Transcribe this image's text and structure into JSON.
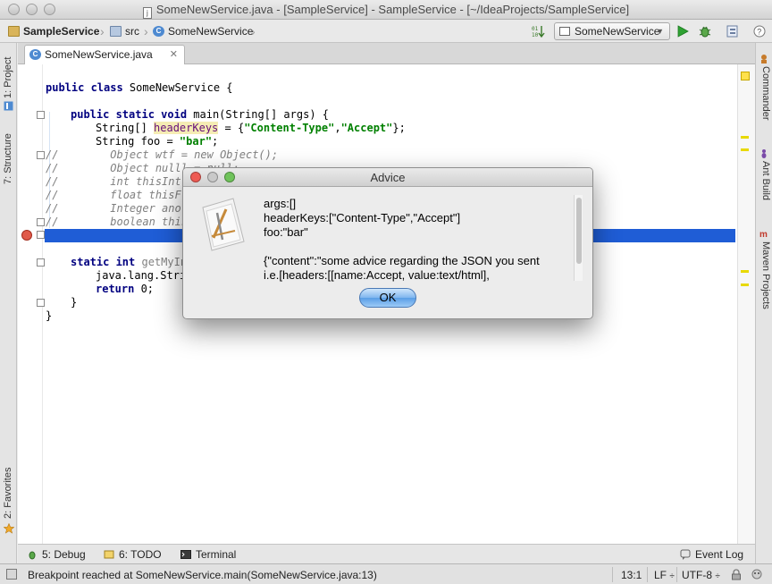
{
  "window": {
    "title": "SomeNewService.java - [SampleService] - SampleService - [~/IdeaProjects/SampleService]"
  },
  "breadcrumbs": [
    "SampleService",
    "src",
    "SomeNewService"
  ],
  "toolbar": {
    "run_config": "SomeNewService"
  },
  "left_tool_tabs": [
    "1: Project",
    "7: Structure",
    "2: Favorites"
  ],
  "right_tool_tabs": [
    "Commander",
    "Ant Build",
    "Maven Projects"
  ],
  "editor": {
    "tab_label": "SomeNewService.java",
    "code": {
      "l1_kw": "public class ",
      "l1_rest": "SomeNewService {",
      "l2_kw": "public static void ",
      "l2_rest": "main(String[] args) {",
      "l3_a": "String[] ",
      "l3_var": "headerKeys",
      "l3_b": " = {",
      "l3_s1": "\"Content-Type\"",
      "l3_c": ",",
      "l3_s2": "\"Accept\"",
      "l3_d": "};",
      "l4_a": "String foo = ",
      "l4_s": "\"bar\"",
      "l4_b": ";",
      "c1": "//        Object wtf = new Object();",
      "c2": "//        Object nulll = null;",
      "c3": "//        int thisInt",
      "c4": "//        float thisFl",
      "c5": "//        Integer anot",
      "c6": "//        boolean this",
      "l5_kw": "static int ",
      "l5_rest": "getMyIn",
      "l6": "java.lang.Stri",
      "l7_kw": "return ",
      "l7_rest": "0;",
      "l8": "}",
      "l9": "}"
    }
  },
  "dialog": {
    "title": "Advice",
    "lines": [
      "args:[]",
      "headerKeys:[\"Content-Type\",\"Accept\"]",
      "foo:\"bar\"",
      "",
      "{\"content\":\"some advice regarding the JSON you sent",
      "i.e.[headers:[[name:Accept, value:text/html],"
    ],
    "ok_label": "OK"
  },
  "bottom_tools": {
    "debug": "5: Debug",
    "todo": "6: TODO",
    "terminal": "Terminal",
    "event_log": "Event Log"
  },
  "status": {
    "message": "Breakpoint reached at SomeNewService.main(SomeNewService.java:13)",
    "position": "13:1",
    "line_sep": "LF",
    "encoding": "UTF-8"
  },
  "colors": {
    "execution_line": "#1f5dd6",
    "keyword": "#000080",
    "string": "#008000",
    "ok_button": "#5a9ee6"
  }
}
